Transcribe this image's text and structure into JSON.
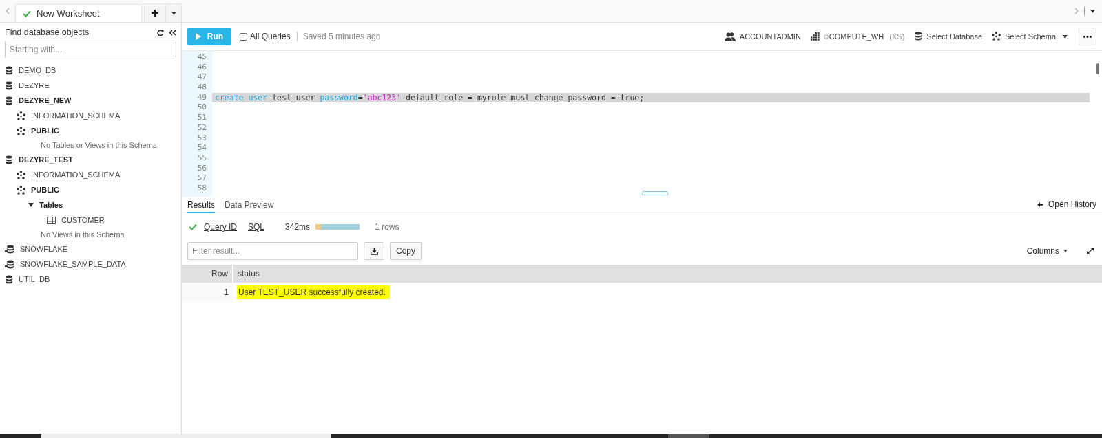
{
  "tabs": [
    {
      "label": "New Worksheet",
      "selected": true
    }
  ],
  "sidebar": {
    "title": "Find database objects",
    "search": {
      "placeholder": "Starting with..."
    },
    "tree": [
      {
        "kind": "database",
        "label": "DEMO_DB",
        "expanded": false
      },
      {
        "kind": "database",
        "label": "DEZYRE",
        "expanded": false
      },
      {
        "kind": "database",
        "label": "DEZYRE_NEW",
        "expanded": true,
        "children": [
          {
            "kind": "schema",
            "label": "INFORMATION_SCHEMA",
            "expanded": false
          },
          {
            "kind": "schema",
            "label": "PUBLIC",
            "expanded": true,
            "children": [
              {
                "kind": "note",
                "label": "No Tables or Views in this Schema"
              }
            ]
          }
        ]
      },
      {
        "kind": "database",
        "label": "DEZYRE_TEST",
        "expanded": true,
        "children": [
          {
            "kind": "schema",
            "label": "INFORMATION_SCHEMA",
            "expanded": false
          },
          {
            "kind": "schema",
            "label": "PUBLIC",
            "expanded": true,
            "children": [
              {
                "kind": "folder",
                "label": "Tables",
                "expanded": true,
                "children": [
                  {
                    "kind": "table",
                    "label": "CUSTOMER"
                  }
                ]
              },
              {
                "kind": "note",
                "label": "No Views in this Schema"
              }
            ]
          }
        ]
      },
      {
        "kind": "shared",
        "label": "SNOWFLAKE",
        "expanded": false
      },
      {
        "kind": "shared",
        "label": "SNOWFLAKE_SAMPLE_DATA",
        "expanded": false
      },
      {
        "kind": "database",
        "label": "UTIL_DB",
        "expanded": false
      }
    ]
  },
  "toolbar": {
    "run": "Run",
    "all_queries": {
      "label": "All Queries",
      "checked": false
    },
    "saved": "Saved 5 minutes ago",
    "role": "ACCOUNTADMIN",
    "warehouse": "COMPUTE_WH",
    "warehouse_size": "(XS)",
    "database": "Select Database",
    "schema": "Select Schema"
  },
  "editor": {
    "lines": [
      {
        "number": "45",
        "highlighted": false
      },
      {
        "number": "46",
        "highlighted": false
      },
      {
        "number": "47",
        "highlighted": false
      },
      {
        "number": "48",
        "highlighted": false
      },
      {
        "number": "49",
        "highlighted": true,
        "tokens": [
          {
            "kind": "keyword",
            "text": "create",
            "attached": true
          },
          {
            "kind": "keyword",
            "text": "user",
            "attached": false
          },
          {
            "kind": "plain",
            "text": "test_user",
            "attached": false
          },
          {
            "kind": "keyword",
            "text": "password",
            "attached": false
          },
          {
            "kind": "plain",
            "text": "=",
            "attached": true
          },
          {
            "kind": "string",
            "text": "'abc123'",
            "attached": true
          },
          {
            "kind": "plain",
            "text": "default_role = myrole must_change_password = true;",
            "attached": false
          }
        ]
      },
      {
        "number": "50",
        "highlighted": false
      },
      {
        "number": "51",
        "highlighted": false
      },
      {
        "number": "52",
        "highlighted": false
      },
      {
        "number": "53",
        "highlighted": false
      },
      {
        "number": "54",
        "highlighted": false
      },
      {
        "number": "55",
        "highlighted": false
      },
      {
        "number": "56",
        "highlighted": false
      },
      {
        "number": "57",
        "highlighted": false
      },
      {
        "number": "58",
        "highlighted": false
      }
    ]
  },
  "results": {
    "tabs": [
      {
        "label": "Results",
        "selected": true
      },
      {
        "label": "Data Preview",
        "selected": false
      }
    ],
    "open_history": "Open History",
    "query_id": "Query ID",
    "sql": "SQL",
    "duration": "342ms",
    "row_count": "1 rows",
    "filter": {
      "placeholder": "Filter result..."
    },
    "copy": "Copy",
    "columns_menu": "Columns",
    "table": {
      "columns": [
        "Row",
        "status"
      ],
      "rows": [
        {
          "cells": [
            "1",
            "User TEST_USER successfully created."
          ],
          "highlighted": true
        }
      ]
    }
  }
}
